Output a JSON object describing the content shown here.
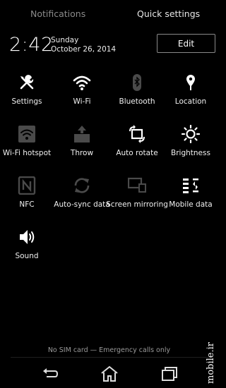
{
  "tabs": {
    "notifications": "Notifications",
    "quick_settings": "Quick settings"
  },
  "header": {
    "time": "2:42",
    "day": "Sunday",
    "date": "October 26, 2014",
    "edit_label": "Edit"
  },
  "tiles": [
    {
      "label": "Settings",
      "icon": "wrench-screwdriver-icon",
      "active": true
    },
    {
      "label": "Wi-Fi",
      "icon": "wifi-icon",
      "active": true
    },
    {
      "label": "Bluetooth",
      "icon": "bluetooth-icon",
      "active": false
    },
    {
      "label": "Location",
      "icon": "location-pin-icon",
      "active": true
    },
    {
      "label": "Wi-Fi hotspot",
      "icon": "wifi-hotspot-icon",
      "active": false
    },
    {
      "label": "Throw",
      "icon": "throw-icon",
      "active": false
    },
    {
      "label": "Auto rotate",
      "icon": "auto-rotate-icon",
      "active": true
    },
    {
      "label": "Brightness",
      "icon": "brightness-icon",
      "active": true
    },
    {
      "label": "NFC",
      "icon": "nfc-icon",
      "active": false
    },
    {
      "label": "Auto-sync data",
      "icon": "sync-icon",
      "active": false
    },
    {
      "label": "Screen mirroring",
      "icon": "screen-mirroring-icon",
      "active": false
    },
    {
      "label": "Mobile data",
      "icon": "mobile-data-icon",
      "active": true
    },
    {
      "label": "Sound",
      "icon": "speaker-icon",
      "active": true
    }
  ],
  "status": {
    "text": "No SIM card — Emergency calls only"
  },
  "watermark": "mobile.ir",
  "colors": {
    "active_icon": "#ffffff",
    "inactive_icon": "#4a4a4a",
    "background": "#000000"
  }
}
